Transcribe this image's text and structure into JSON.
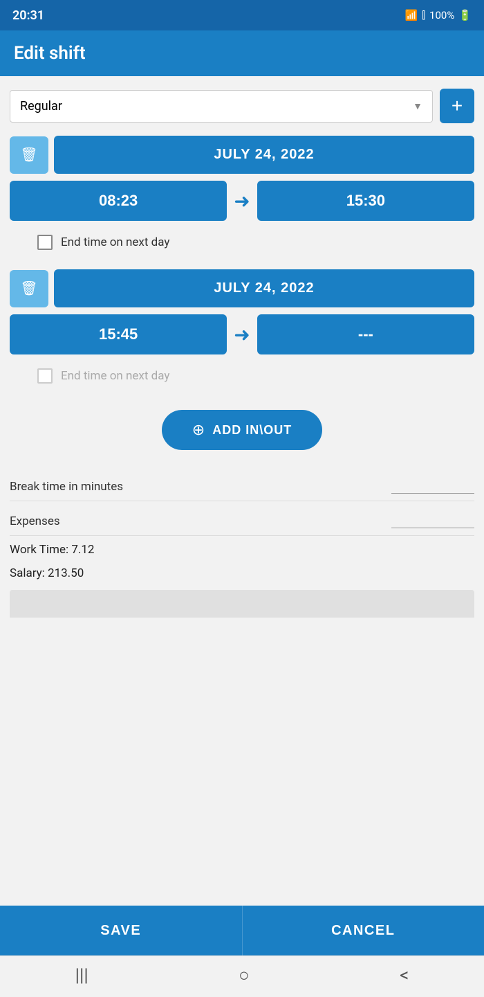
{
  "statusBar": {
    "time": "20:31",
    "battery": "100%"
  },
  "header": {
    "title": "Edit shift"
  },
  "typeSelector": {
    "value": "Regular",
    "addLabel": "+"
  },
  "shift1": {
    "date": "JULY 24, 2022",
    "startTime": "08:23",
    "endTime": "15:30",
    "nextDayLabel": "End time on next day",
    "nextDayDisabled": false
  },
  "shift2": {
    "date": "JULY 24, 2022",
    "startTime": "15:45",
    "endTime": "---",
    "nextDayLabel": "End time on next day",
    "nextDayDisabled": true
  },
  "addInOut": {
    "label": "ADD IN\\OUT"
  },
  "breakTime": {
    "label": "Break time in minutes",
    "value": ""
  },
  "expenses": {
    "label": "Expenses",
    "value": ""
  },
  "workTime": {
    "label": "Work Time: 7.12"
  },
  "salary": {
    "label": "Salary: 213.50"
  },
  "footer": {
    "saveLabel": "SAVE",
    "cancelLabel": "CANCEL"
  },
  "nav": {
    "menuIcon": "|||",
    "homeIcon": "○",
    "backIcon": "<"
  }
}
